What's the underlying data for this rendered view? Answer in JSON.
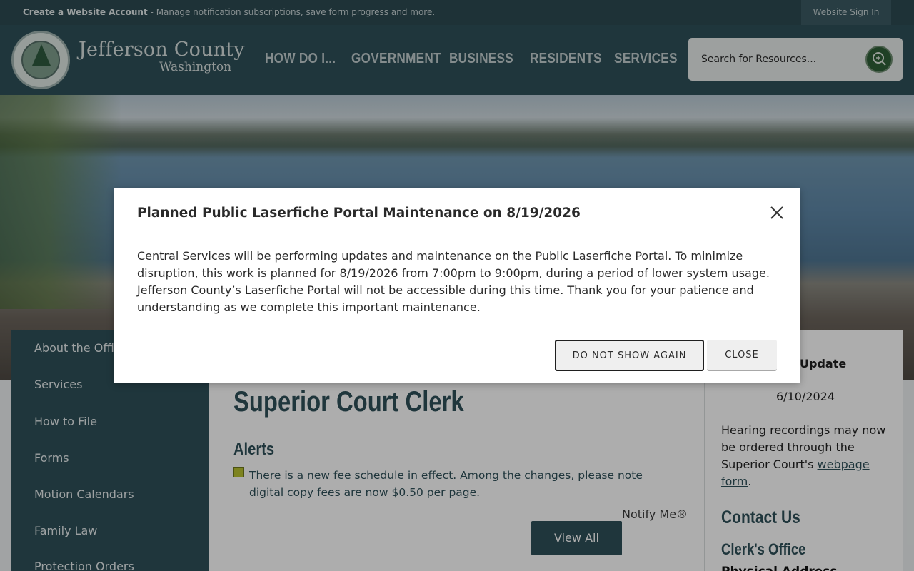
{
  "topbar": {
    "create_account": "Create a Website Account",
    "create_account_desc": "- Manage notification subscriptions, save form progress and more.",
    "sign_in": "Website Sign In"
  },
  "header": {
    "logo_name": "Jefferson County",
    "logo_sub": "Washington",
    "nav": [
      "HOW DO I...",
      "GOVERNMENT",
      "BUSINESS",
      "RESIDENTS",
      "SERVICES"
    ],
    "search_placeholder": "Search for Resources..."
  },
  "sidebar": {
    "items": [
      "About the Office",
      "Services",
      "How to File",
      "Forms",
      "Motion Calendars",
      "Family Law",
      "Protection Orders"
    ]
  },
  "main": {
    "title": "Superior Court Clerk",
    "alerts_heading": "Alerts",
    "alert_text": "There is a new fee schedule in effect. Among the changes, please note digital copy fees are now $0.50 per page.",
    "notify_me": "Notify Me®",
    "view_all": "View All"
  },
  "right": {
    "update_heading": "Update",
    "update_date": "6/10/2024",
    "update_text_before": "Hearing recordings may now be ordered through the Superior Court's ",
    "update_link": "webpage form",
    "update_text_after": ".",
    "contact_heading": "Contact Us",
    "office_heading": "Clerk's Office",
    "physical_address": "Physical Address"
  },
  "modal": {
    "title": "Planned Public Laserfiche Portal Maintenance on 8/19/2026",
    "body": "Central Services will be performing updates and maintenance on the Public Laserfiche Portal. To minimize disruption, this work is planned for 8/19/2026 from 7:00pm to 9:00pm, during a period of lower system usage. Jefferson County’s Laserfiche Portal will not be accessible during this time. Thank you for your patience and understanding as we complete this important maintenance.",
    "do_not_show": "DO NOT SHOW AGAIN",
    "close": "CLOSE"
  }
}
